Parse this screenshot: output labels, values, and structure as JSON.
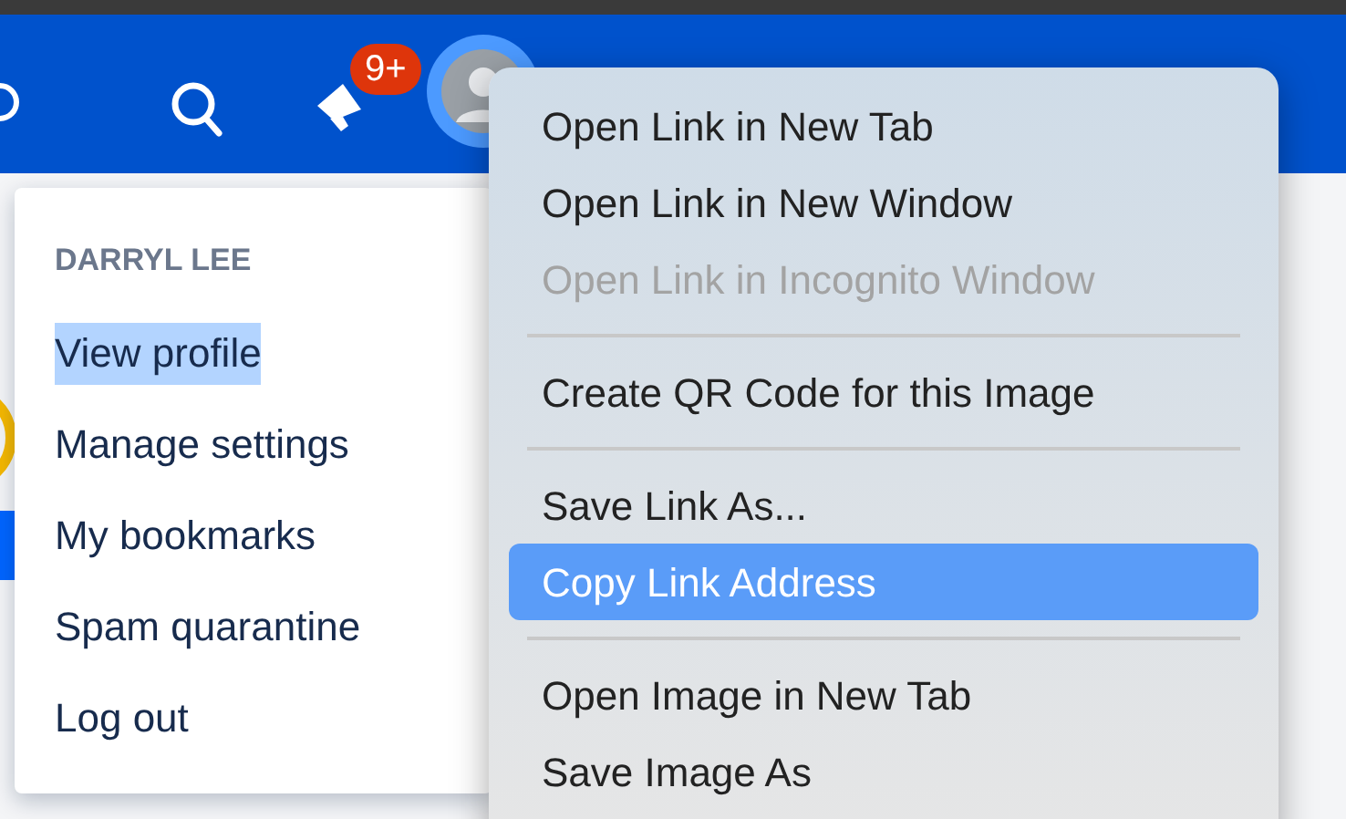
{
  "header": {
    "notification_badge": "9+"
  },
  "user_menu": {
    "title": "DARRYL LEE",
    "items": [
      {
        "label": "View profile",
        "selected": true
      },
      {
        "label": "Manage settings",
        "selected": false
      },
      {
        "label": "My bookmarks",
        "selected": false
      },
      {
        "label": "Spam quarantine",
        "selected": false
      },
      {
        "label": "Log out",
        "selected": false
      }
    ]
  },
  "context_menu": {
    "items": [
      {
        "kind": "item",
        "label": "Open Link in New Tab",
        "disabled": false,
        "selected": false
      },
      {
        "kind": "item",
        "label": "Open Link in New Window",
        "disabled": false,
        "selected": false
      },
      {
        "kind": "item",
        "label": "Open Link in Incognito Window",
        "disabled": true,
        "selected": false
      },
      {
        "kind": "separator"
      },
      {
        "kind": "item",
        "label": "Create QR Code for this Image",
        "disabled": false,
        "selected": false
      },
      {
        "kind": "separator"
      },
      {
        "kind": "item",
        "label": "Save Link As...",
        "disabled": false,
        "selected": false
      },
      {
        "kind": "item",
        "label": "Copy Link Address",
        "disabled": false,
        "selected": true
      },
      {
        "kind": "separator"
      },
      {
        "kind": "item",
        "label": "Open Image in New Tab",
        "disabled": false,
        "selected": false
      },
      {
        "kind": "item",
        "label": "Save Image As",
        "disabled": false,
        "selected": false
      }
    ]
  }
}
